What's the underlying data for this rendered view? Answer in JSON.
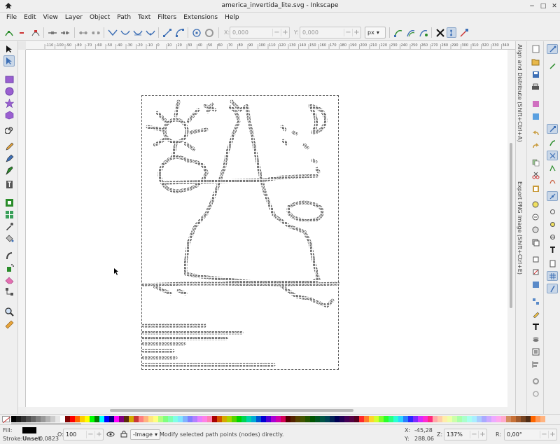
{
  "window": {
    "title": "america_invertida_lite.svg - Inkscape",
    "minimize": "−",
    "maximize": "□",
    "close": "✕"
  },
  "menu": [
    "File",
    "Edit",
    "View",
    "Layer",
    "Object",
    "Path",
    "Text",
    "Filters",
    "Extensions",
    "Help"
  ],
  "toolcontrols": {
    "x_label": "X:",
    "x_value": "0,000",
    "y_label": "Y:",
    "y_value": "0,000",
    "unit": "px",
    "minus": "−",
    "plus": "+"
  },
  "ruler": {
    "top_ticks": [
      "-110",
      "-100",
      "-90",
      "-80",
      "-70",
      "-60",
      "-50",
      "-40",
      "-30",
      "-20",
      "-10",
      "0",
      "10",
      "20",
      "30",
      "40",
      "50",
      "60",
      "70",
      "80",
      "90",
      "100",
      "110",
      "120",
      "130",
      "140",
      "150",
      "160",
      "170",
      "180",
      "190",
      "200",
      "210",
      "220",
      "230",
      "240",
      "250",
      "260",
      "270",
      "280",
      "290",
      "300",
      "310",
      "320",
      "330",
      "340"
    ]
  },
  "dock_tabs": {
    "align": "Align and Distribute (Shift+Ctrl+A)",
    "export": "Export PNG Image (Shift+Ctrl+E)"
  },
  "statusbar": {
    "fill_label": "Fill:",
    "stroke_label": "Stroke:",
    "stroke_value": "Unset",
    "stroke_width": "0,0823",
    "opacity_label": "O:",
    "opacity_value": "100",
    "layer": "-Image",
    "message": "Modify selected path points (nodes) directly.",
    "x_label": "X:",
    "x_value": "-45,28",
    "y_label": "Y:",
    "y_value": "288,06",
    "zoom_label": "Z:",
    "zoom_value": "137%",
    "rotate_label": "R:",
    "rotate_value": "0,00°",
    "minus": "−",
    "plus": "+"
  },
  "colors": {
    "accent": "#3d6fb5",
    "selection": "#c9d7e8",
    "fill_swatch": "#000000"
  },
  "palette": [
    "#000000",
    "#1a1a1a",
    "#333333",
    "#4d4d4d",
    "#666666",
    "#808080",
    "#999999",
    "#b3b3b3",
    "#cccccc",
    "#e6e6e6",
    "#ffffff",
    "#800000",
    "#ff0000",
    "#ff6600",
    "#ffcc00",
    "#ffff00",
    "#00ff00",
    "#008000",
    "#00ffff",
    "#0000ff",
    "#000080",
    "#ff00ff",
    "#800080",
    "#5a2d0c",
    "#d4aa00",
    "#c83737",
    "#ff8080",
    "#ffb380",
    "#ffe680",
    "#ffff80",
    "#b3ff80",
    "#80ff80",
    "#80ffb3",
    "#80ffe6",
    "#80e6ff",
    "#80b3ff",
    "#8080ff",
    "#b380ff",
    "#e680ff",
    "#ff80e6",
    "#ff80b3",
    "#aa0000",
    "#d45500",
    "#d4aa00",
    "#aad400",
    "#55d400",
    "#00d400",
    "#00d455",
    "#00d4aa",
    "#00aad4",
    "#0055d4",
    "#0000d4",
    "#5500d4",
    "#aa00d4",
    "#d400aa",
    "#d40055",
    "#550000",
    "#552200",
    "#554400",
    "#445500",
    "#225500",
    "#005500",
    "#005522",
    "#005544",
    "#004455",
    "#002255",
    "#000055",
    "#220055",
    "#440055",
    "#550044",
    "#550022",
    "#ff2a2a",
    "#ff7f2a",
    "#ffd42a",
    "#d4ff2a",
    "#7fff2a",
    "#2aff2a",
    "#2aff7f",
    "#2affd4",
    "#2ad4ff",
    "#2a7fff",
    "#2a2aff",
    "#7f2aff",
    "#d42aff",
    "#ff2ad4",
    "#ff2a7f",
    "#ffaaaa",
    "#ffccaa",
    "#ffeeaa",
    "#eeffaa",
    "#ccffaa",
    "#aaffaa",
    "#aaffcc",
    "#aaffee",
    "#aaeeff",
    "#aaccff",
    "#aaaaff",
    "#ccaaff",
    "#eeaaff",
    "#ffaaee",
    "#ffaacc",
    "#d38d5f",
    "#c87137",
    "#a05a2c",
    "#784421",
    "#502d16",
    "#ff6600",
    "#ff9955",
    "#ffb380"
  ],
  "icons": {
    "toolbox": [
      "selector-tool-icon",
      "node-tool-icon",
      "rect-tool-icon",
      "circle-tool-icon",
      "star-tool-icon",
      "3dbox-tool-icon",
      "spiral-tool-icon",
      "pencil-tool-icon",
      "pen-tool-icon",
      "calligraphy-tool-icon",
      "text-tool-icon",
      "gradient-tool-icon",
      "mesh-tool-icon",
      "dropper-tool-icon",
      "paintbucket-tool-icon",
      "tweak-tool-icon",
      "spray-tool-icon",
      "eraser-tool-icon",
      "connector-tool-icon",
      "zoom-tool-icon",
      "measure-tool-icon"
    ]
  }
}
